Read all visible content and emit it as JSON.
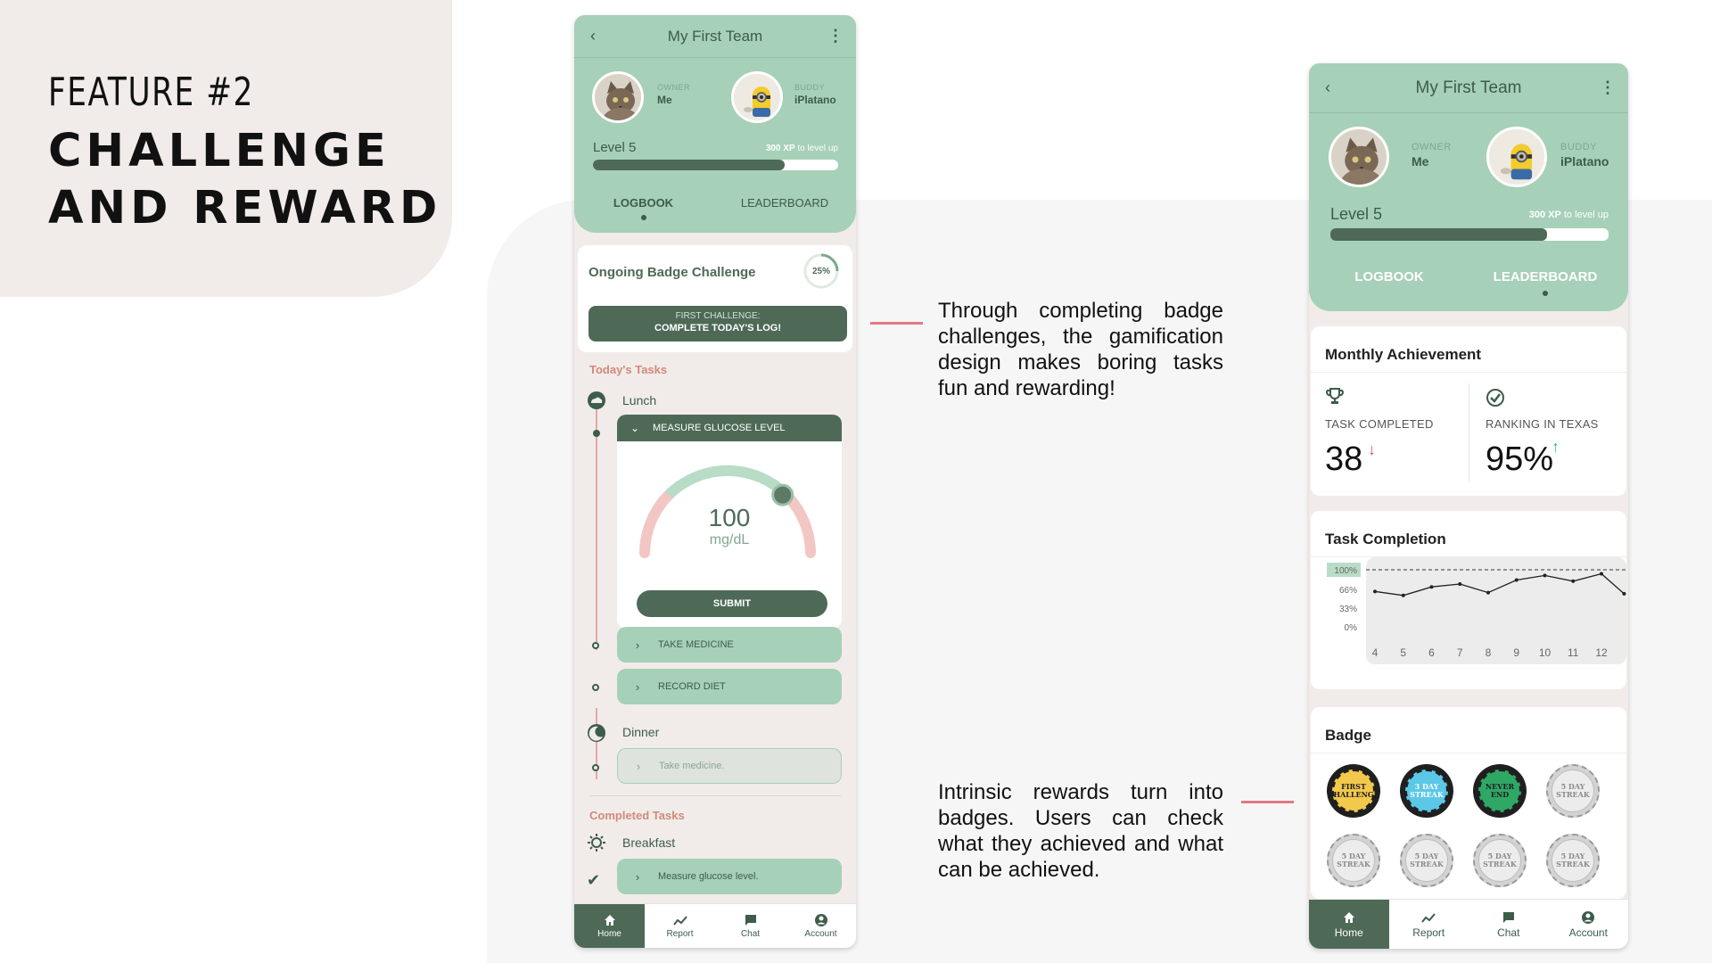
{
  "slide": {
    "feature_number": "FEATURE #2",
    "feature_title_line1": "CHALLENGE",
    "feature_title_line2": "AND REWARD",
    "annotation_1": "Through completing badge challenges, the gamification design makes boring tasks fun and rewarding!",
    "annotation_2": "Intrinsic rewards turn into badges. Users can check what they achieved and what can be achieved.",
    "connector_color": "#e07a84"
  },
  "colors": {
    "mint": "#a6d0b7",
    "dark_green": "#4e6a57",
    "cream": "#f1ece9",
    "salmon": "#d08a7a",
    "pink_gauge": "#f2c7c3",
    "up_arrow": "#2fbf71",
    "down_arrow": "#e0564f"
  },
  "common": {
    "team_title": "My First Team",
    "owner_role": "OWNER",
    "owner_name": "Me",
    "buddy_role": "BUDDY",
    "buddy_name": "iPlatano",
    "level": "Level 5",
    "xp_amount": "300 XP",
    "xp_suffix": " to level up",
    "level_progress": 0.78,
    "tab_logbook": "LOGBOOK",
    "tab_leaderboard": "LEADERBOARD",
    "nav": {
      "home": "Home",
      "report": "Report",
      "chat": "Chat",
      "account": "Account"
    }
  },
  "logbook": {
    "challenge_title": "Ongoing Badge Challenge",
    "challenge_progress": "25%",
    "challenge_progress_value": 0.25,
    "challenge_line1": "FIRST CHALLENGE:",
    "challenge_line2": "COMPLETE TODAY'S LOG!",
    "todays_tasks": "Today's Tasks",
    "lunch": "Lunch",
    "measure_glucose": "MEASURE GLUCOSE LEVEL",
    "glucose_value": "100",
    "glucose_unit": "mg/dL",
    "gauge_level": 0.7,
    "submit": "SUBMIT",
    "take_medicine": "TAKE MEDICINE",
    "record_diet": "RECORD DIET",
    "dinner": "Dinner",
    "dinner_task": "Take medicine.",
    "completed_tasks": "Completed Tasks",
    "breakfast": "Breakfast",
    "breakfast_task": "Measure glucose level."
  },
  "leaderboard": {
    "monthly_title": "Monthly Achievement",
    "task_completed_label": "TASK COMPLETED",
    "task_completed_value": "38",
    "task_completed_arrow": "↓",
    "ranking_label": "RANKING IN TEXAS",
    "ranking_value": "95%",
    "ranking_arrow": "↑",
    "completion_title": "Task Completion",
    "badge_title": "Badge",
    "badges": [
      {
        "line1": "FIRST",
        "line2": "CHALLENGE",
        "style": "gold"
      },
      {
        "line1": "3 DAY",
        "line2": "STREAK",
        "style": "blue"
      },
      {
        "line1": "NEVER",
        "line2": "END",
        "style": "green"
      },
      {
        "line1": "5 DAY",
        "line2": "STREAK",
        "style": "grey"
      },
      {
        "line1": "5 DAY",
        "line2": "STREAK",
        "style": "grey"
      },
      {
        "line1": "5 DAY",
        "line2": "STREAK",
        "style": "grey"
      },
      {
        "line1": "5 DAY",
        "line2": "STREAK",
        "style": "grey"
      },
      {
        "line1": "5 DAY",
        "line2": "STREAK",
        "style": "grey"
      }
    ]
  },
  "chart_data": {
    "type": "line",
    "title": "Task Completion",
    "xlabel": "",
    "ylabel": "",
    "x_ticks": [
      "4",
      "5",
      "6",
      "7",
      "8",
      "9",
      "10",
      "11",
      "12"
    ],
    "y_ticks": [
      "100%",
      "66%",
      "33%",
      "0%"
    ],
    "y_highlight": "100%",
    "ylim": [
      0,
      100
    ],
    "series": [
      {
        "x": [
          4,
          5,
          6,
          7,
          8,
          9,
          10,
          11,
          12,
          12.8
        ],
        "values": [
          62,
          55,
          70,
          75,
          60,
          82,
          90,
          80,
          93,
          58
        ]
      }
    ],
    "dashed_reference": 100,
    "grid": false
  }
}
